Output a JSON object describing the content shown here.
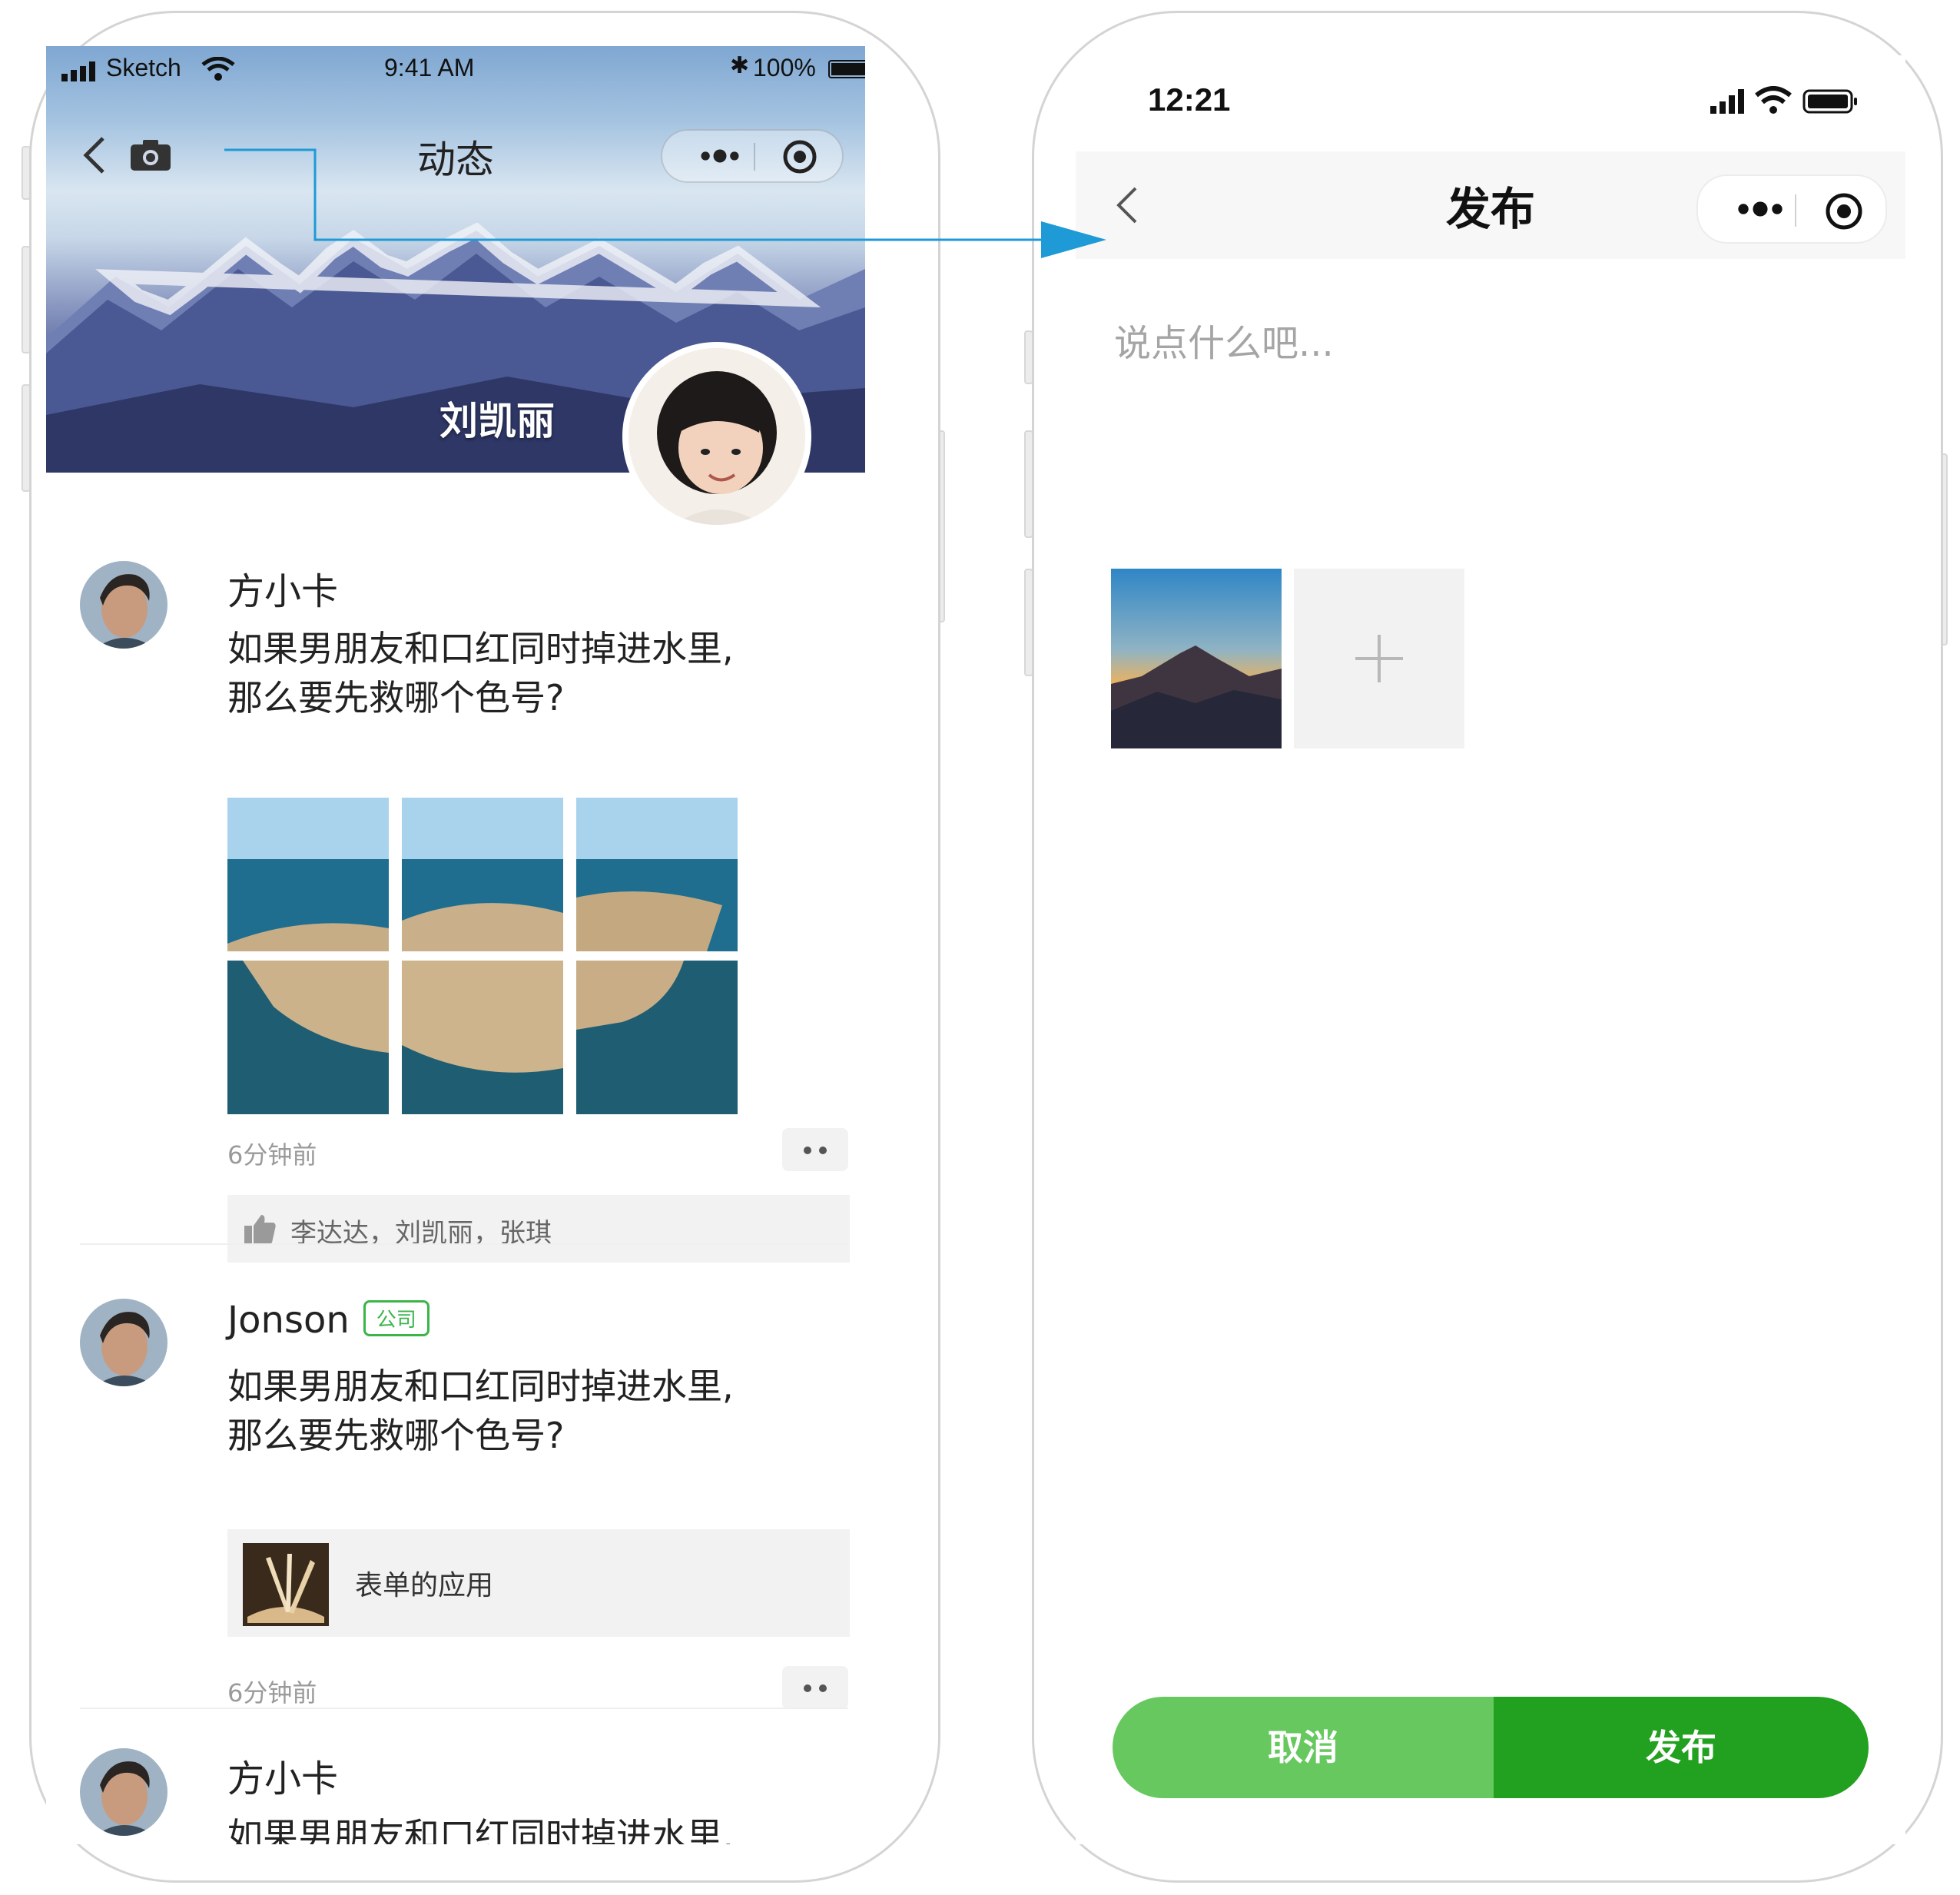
{
  "left_screen": {
    "status_bar": {
      "carrier": "Sketch",
      "time": "9:41 AM",
      "battery": "100%"
    },
    "nav": {
      "title": "动态"
    },
    "profile": {
      "name": "刘凯丽"
    },
    "posts": [
      {
        "name": "方小卡",
        "text_line1": "如果男朋友和口红同时掉进水里,",
        "text_line2": "那么要先救哪个色号?",
        "time": "6分钟前",
        "likes": "李达达，刘凯丽，张琪"
      },
      {
        "name": "Jonson",
        "badge": "公司",
        "text_line1": "如果男朋友和口红同时掉进水里,",
        "text_line2": "那么要先救哪个色号?",
        "link_title": "表单的应用",
        "time": "6分钟前"
      },
      {
        "name": "方小卡",
        "text_line1": "如果男朋友和口红同时掉进水里,"
      }
    ]
  },
  "right_screen": {
    "status_bar": {
      "time": "12:21"
    },
    "nav": {
      "title": "发布"
    },
    "input": {
      "placeholder": "说点什么吧..."
    },
    "buttons": {
      "cancel": "取消",
      "publish": "发布"
    }
  },
  "colors": {
    "connector": "#1e9ad6",
    "cancel_button": "#66c85e",
    "publish_button": "#22a01f",
    "badge_green": "#3bb54a"
  },
  "icons": [
    "back-icon",
    "camera-icon",
    "more-dots-icon",
    "target-icon",
    "thumb-up-icon",
    "plus-icon",
    "signal-icon",
    "wifi-icon",
    "battery-icon",
    "bluetooth-icon"
  ]
}
